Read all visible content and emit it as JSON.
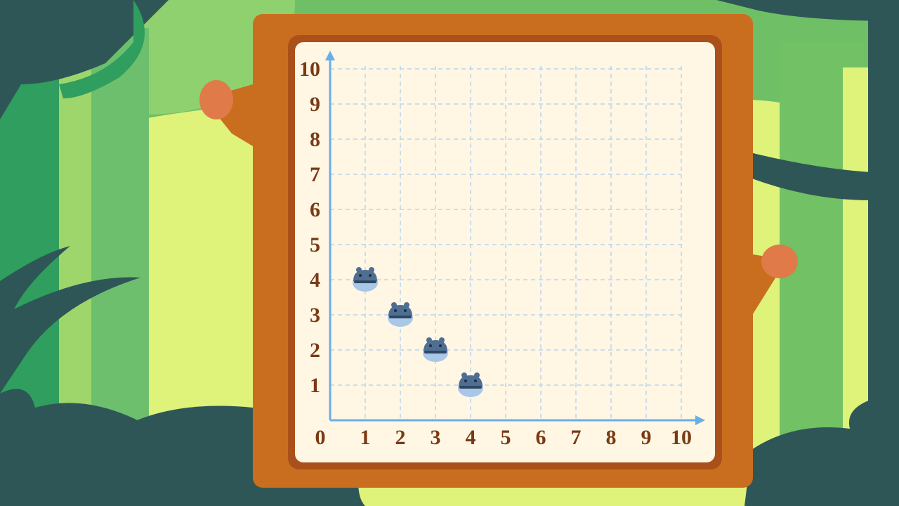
{
  "chart_data": {
    "type": "scatter",
    "x_ticks": [
      "0",
      "1",
      "2",
      "3",
      "4",
      "5",
      "6",
      "7",
      "8",
      "9",
      "10"
    ],
    "y_ticks": [
      "1",
      "2",
      "3",
      "4",
      "5",
      "6",
      "7",
      "8",
      "9",
      "10"
    ],
    "xlim": [
      0,
      10
    ],
    "ylim": [
      0,
      10
    ],
    "grid": true,
    "points": [
      {
        "x": 1,
        "y": 4,
        "marker": "hippo-icon"
      },
      {
        "x": 2,
        "y": 3,
        "marker": "hippo-icon"
      },
      {
        "x": 3,
        "y": 2,
        "marker": "hippo-icon"
      },
      {
        "x": 4,
        "y": 1,
        "marker": "hippo-icon"
      }
    ]
  },
  "colors": {
    "frame": "#c96e1f",
    "frame_inner": "#a9501b",
    "paper": "#fff6e4",
    "axis": "#6aaee6",
    "grid": "#b9d6ee",
    "tick_text": "#7a3a14",
    "hippo_body": "#4e6f93",
    "hippo_belly": "#a9c7e6"
  }
}
